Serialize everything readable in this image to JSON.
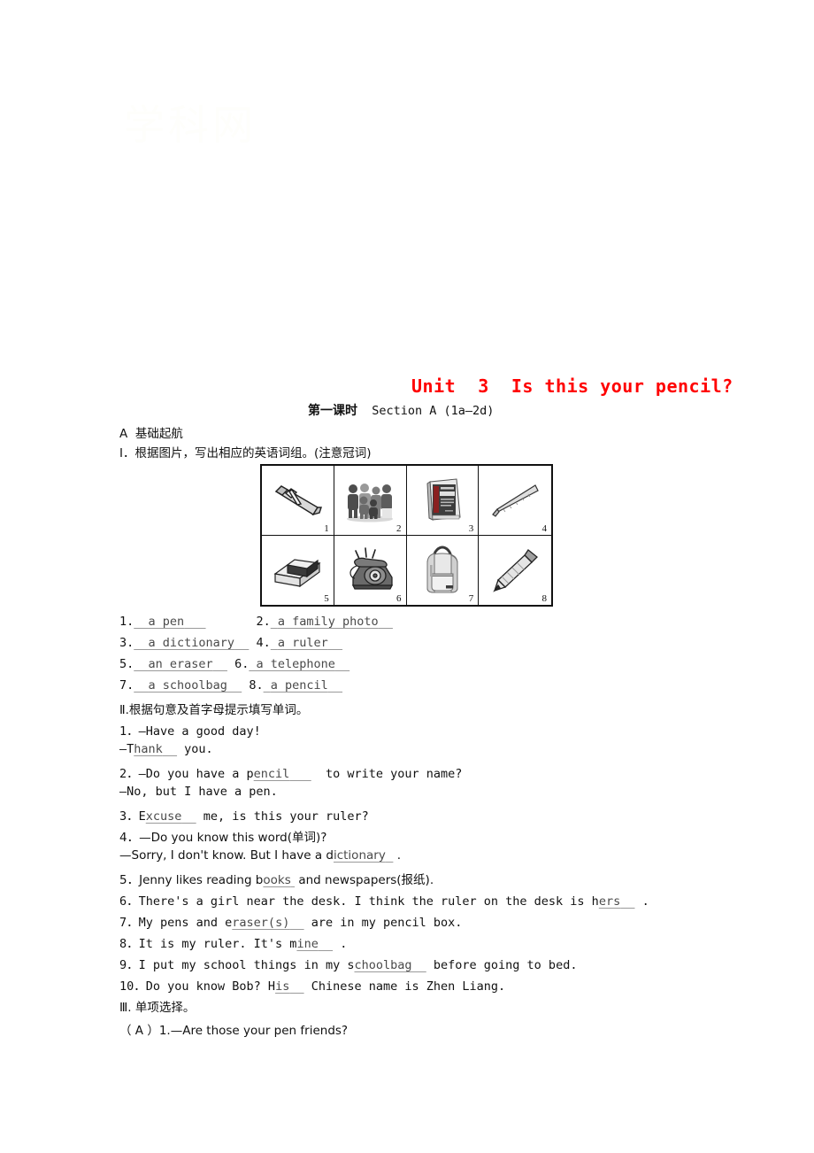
{
  "document": {
    "watermark": "学科网",
    "unit_title": "Unit  3  Is this your pencil?",
    "unit_title_color": "#ff0000",
    "lesson_cn": "第一课时",
    "lesson_en": "Section A (1a—2d)",
    "section_a_label": "A  基础起航",
    "part1_heading": "Ⅰ．根据图片，写出相应的英语词组。(注意冠词)",
    "part2_heading": "Ⅱ.根据句意及首字母提示填写单词。",
    "part3_heading": "Ⅲ. 单项选择。"
  },
  "picture_grid": {
    "cells": [
      {
        "num": "1",
        "icon": "pen-icon",
        "answer": "a pen"
      },
      {
        "num": "2",
        "icon": "family-photo-icon",
        "answer": "a family photo"
      },
      {
        "num": "3",
        "icon": "dictionary-icon",
        "answer": "a dictionary"
      },
      {
        "num": "4",
        "icon": "ruler-icon",
        "answer": "a ruler"
      },
      {
        "num": "5",
        "icon": "eraser-icon",
        "answer": "an eraser"
      },
      {
        "num": "6",
        "icon": "telephone-icon",
        "answer": "a telephone"
      },
      {
        "num": "7",
        "icon": "schoolbag-icon",
        "answer": "a schoolbag"
      },
      {
        "num": "8",
        "icon": "pencil-icon",
        "answer": "a pencil"
      }
    ]
  },
  "part1_answers": [
    {
      "n1": "1.",
      "a1": "a pen",
      "n2": "2.",
      "a2": "a family photo"
    },
    {
      "n1": "3.",
      "a1": "a dictionary",
      "n2": "4.",
      "a2": "a ruler"
    },
    {
      "n1": "5.",
      "a1": "an eraser",
      "n2": "6.",
      "a2": "a telephone"
    },
    {
      "n1": "7.",
      "a1": "a schoolbag",
      "n2": "8.",
      "a2": "a pencil"
    }
  ],
  "part2_items": [
    {
      "pre": "1．—Have a good day!"
    },
    {
      "pre": "—T",
      "ans": "hank",
      "post": " you."
    },
    {
      "pre": "2．—Do you have a p",
      "ans": "encil",
      "post": "  to write your name?"
    },
    {
      "pre": "—No, but I have a pen."
    },
    {
      "pre": "3．E",
      "ans": "xcuse",
      "post": " me, is this your ruler?"
    },
    {
      "pre": "4．—Do you know this word(单词)?"
    },
    {
      "pre": "—Sorry, I don't know. But I have a d",
      "ans": "ictionary",
      "post": " ."
    },
    {
      "pre": "5．Jenny likes reading b",
      "ans": "ooks",
      "post": " and newspapers(报纸)."
    },
    {
      "pre": "6．There's a girl near the desk. I think the ruler on the desk is h",
      "ans": "ers",
      "post": " ."
    },
    {
      "pre": "7．My pens and e",
      "ans": "raser(s)",
      "post": " are in my pencil box."
    },
    {
      "pre": "8．It is my ruler. It's m",
      "ans": "ine",
      "post": " ."
    },
    {
      "pre": "9．I put my school things in my s",
      "ans": "choolbag",
      "post": " before going to bed."
    },
    {
      "pre": "10．Do you know Bob? H",
      "ans": "is",
      "post": " Chinese name is Zhen Liang."
    }
  ],
  "part3_items": [
    {
      "choice": "（ A ）",
      "text": "1.—Are those your pen friends?"
    }
  ]
}
